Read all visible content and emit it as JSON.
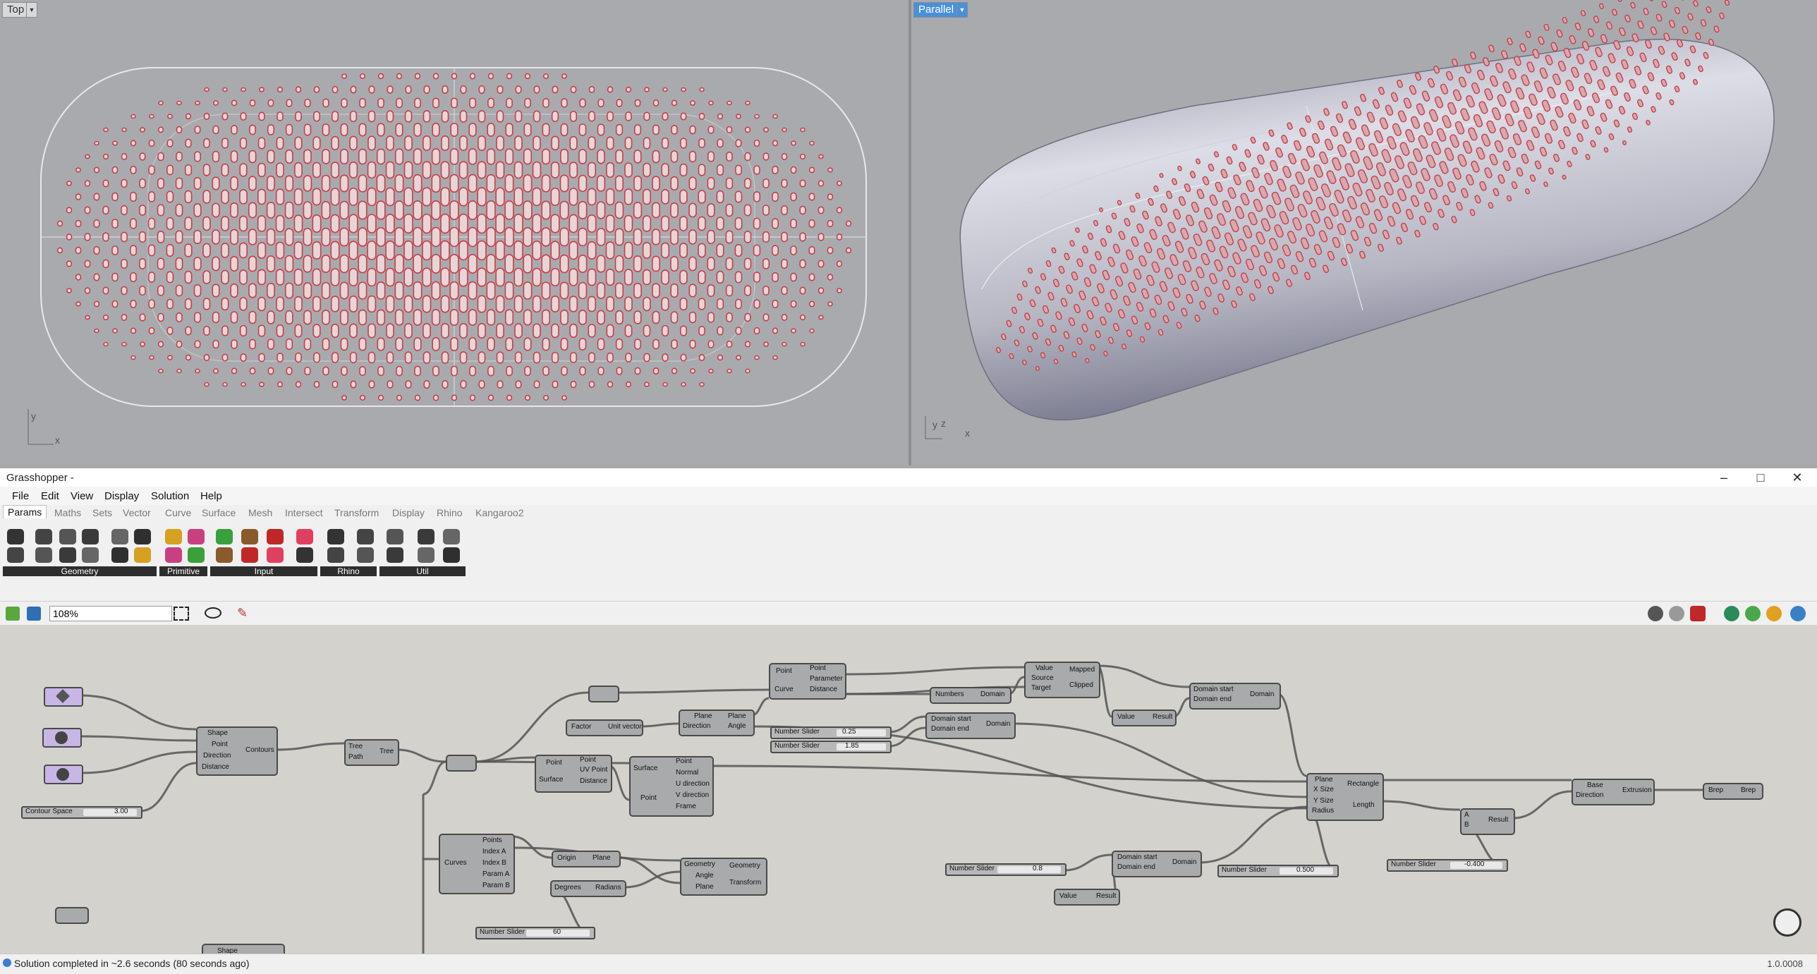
{
  "viewports": {
    "top": {
      "label": "Top",
      "axes": [
        "y",
        "x"
      ]
    },
    "parallel": {
      "label": "Parallel",
      "axes": [
        "y",
        "z",
        "x"
      ]
    }
  },
  "grasshopper": {
    "title": "Grasshopper -",
    "menu": [
      "File",
      "Edit",
      "View",
      "Display",
      "Solution",
      "Help"
    ],
    "tabs": [
      "Params",
      "Maths",
      "Sets",
      "Vector",
      "Curve",
      "Surface",
      "Mesh",
      "Intersect",
      "Transform",
      "Display",
      "Rhino",
      "Kangaroo2"
    ],
    "active_tab": "Params",
    "ribbon_groups": [
      "Geometry",
      "Primitive",
      "Input",
      "Rhino",
      "Util"
    ],
    "zoom": "108%",
    "status": "Solution completed in ~2.6 seconds (80 seconds ago)",
    "version": "1.0.0008"
  },
  "nodes": {
    "contours": {
      "title": "Contours",
      "inputs": [
        "Shape",
        "Point",
        "Direction",
        "Distance"
      ]
    },
    "tree": {
      "title": "Tree",
      "inputs": [
        "Tree",
        "Path"
      ]
    },
    "evaluate_surface": {
      "inputs": [
        "Point",
        "Surface"
      ],
      "outputs": [
        "Point",
        "UV Point",
        "Distance"
      ]
    },
    "unit_vector": {
      "inputs": [
        "Factor"
      ],
      "outputs": [
        "Unit vector"
      ]
    },
    "surface_frame": {
      "inputs": [
        "Surface",
        "Point"
      ],
      "outputs": [
        "Point",
        "Normal",
        "U direction",
        "V direction",
        "Frame"
      ]
    },
    "angle": {
      "inputs": [
        "Plane",
        "Direction"
      ],
      "outputs": [
        "Plane",
        "Angle"
      ]
    },
    "curve_closest": {
      "inputs": [
        "Point",
        "Curve"
      ],
      "outputs": [
        "Point",
        "Parameter",
        "Distance"
      ]
    },
    "bounds": {
      "inputs": [
        "Numbers"
      ],
      "outputs": [
        "Domain"
      ]
    },
    "construct_domain_1": {
      "inputs": [
        "Domain start",
        "Domain end"
      ],
      "outputs": [
        "Domain"
      ]
    },
    "remap": {
      "inputs": [
        "Value",
        "Source",
        "Target"
      ],
      "outputs": [
        "Mapped",
        "Clipped"
      ]
    },
    "negative_1": {
      "inputs": [
        "Value"
      ],
      "outputs": [
        "Result"
      ]
    },
    "construct_domain_2": {
      "inputs": [
        "Domain start",
        "Domain end"
      ],
      "outputs": [
        "Domain"
      ]
    },
    "rectangle": {
      "inputs": [
        "Plane",
        "X Size",
        "Y Size",
        "Radius"
      ],
      "outputs": [
        "Rectangle",
        "Length"
      ]
    },
    "extrusion": {
      "inputs": [
        "Base",
        "Direction"
      ],
      "outputs": [
        "Extrusion"
      ]
    },
    "brep": {
      "inputs": [
        "Brep"
      ],
      "outputs": [
        "Brep"
      ]
    },
    "multiply": {
      "inputs": [
        "A",
        "B"
      ],
      "outputs": [
        "Result"
      ]
    },
    "list_item": {
      "inputs": [
        "Curves"
      ],
      "outputs": [
        "Points",
        "Index A",
        "Index B",
        "Param A",
        "Param B"
      ]
    },
    "plane": {
      "inputs": [
        "Origin"
      ],
      "outputs": [
        "Plane"
      ]
    },
    "radians": {
      "inputs": [
        "Degrees"
      ],
      "outputs": [
        "Radians"
      ]
    },
    "rotate": {
      "inputs": [
        "Geometry",
        "Angle",
        "Plane"
      ],
      "outputs": [
        "Geometry",
        "Transform"
      ]
    },
    "construct_domain_3": {
      "inputs": [
        "Domain start",
        "Domain end"
      ],
      "outputs": [
        "Domain"
      ]
    },
    "negative_2": {
      "inputs": [
        "Value"
      ],
      "outputs": [
        "Result"
      ]
    },
    "shape_bottom": {
      "inputs": [
        "Shape"
      ]
    }
  },
  "sliders": {
    "contour_space": {
      "name": "Contour Space",
      "value": "3.00"
    },
    "s1": {
      "name": "Number Slider",
      "value": "0.25"
    },
    "s2": {
      "name": "Number Slider",
      "value": "1.85"
    },
    "s3": {
      "name": "Number Slider",
      "value": "0.8"
    },
    "s4": {
      "name": "Number Slider",
      "value": "0.500"
    },
    "s5": {
      "name": "Number Slider",
      "value": "-0.400"
    },
    "s6": {
      "name": "Number Slider",
      "value": "60"
    }
  },
  "colors": {
    "accent": "#4a90d9",
    "hole": "#c2404a",
    "canvas": "#d4d2cc"
  }
}
